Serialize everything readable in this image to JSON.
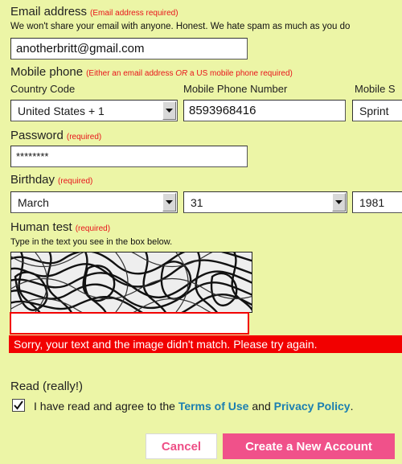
{
  "email": {
    "label": "Email address",
    "required_note": "(Email address required)",
    "privacy_note": "We won't share your email with anyone. Honest. We hate spam as much as you do",
    "value": "anotherbritt@gmail.com"
  },
  "mobile": {
    "label": "Mobile phone",
    "required_note": "(Either an email address OR a US mobile phone required)",
    "country_label": "Country Code",
    "country_value": "United States + 1",
    "number_label": "Mobile Phone Number",
    "number_value": "8593968416",
    "carrier_label": "Mobile S",
    "carrier_value": "Sprint"
  },
  "password": {
    "label": "Password",
    "required_note": "(required)",
    "value": "********"
  },
  "birthday": {
    "label": "Birthday",
    "required_note": "(required)",
    "month": "March",
    "day": "31",
    "year": "1981"
  },
  "human_test": {
    "label": "Human test",
    "required_note": "(required)",
    "instruction": "Type in the text you see in the box below.",
    "input_value": "",
    "error": "Sorry, your text and the image didn't match. Please try again."
  },
  "terms": {
    "label": "Read (really!)",
    "agree_prefix": "I have read and agree to the",
    "terms_link": "Terms of Use",
    "and": "and",
    "privacy_link": "Privacy Policy",
    "period": ".",
    "checked": true
  },
  "buttons": {
    "cancel": "Cancel",
    "create": "Create a New Account"
  },
  "colors": {
    "background": "#ecf5a6",
    "required": "#e8141b",
    "error": "#f20000",
    "link": "#1b7fb1",
    "accent": "#f0518a"
  }
}
